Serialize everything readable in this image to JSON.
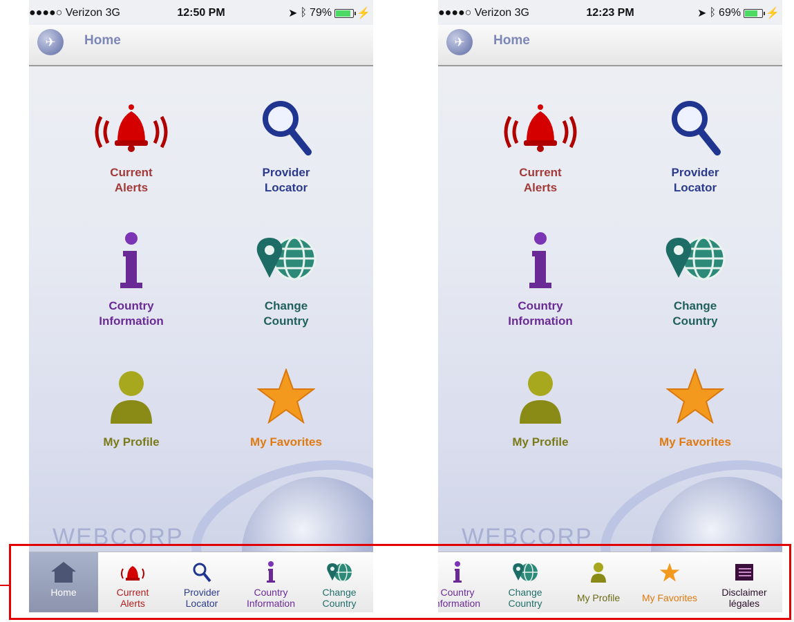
{
  "colors": {
    "alerts": "#a33a3a",
    "provider": "#2b3a8c",
    "country_info": "#6a2a96",
    "change_country": "#1f5f5c",
    "profile": "#7a7a1a",
    "favorites": "#e07a10",
    "active_tab_bg": "#9aa2bd",
    "red_outline": "#e30000"
  },
  "phones": [
    {
      "status": {
        "carrier": "●●●●○ Verizon  3G",
        "time": "12:50 PM",
        "battery": "79%",
        "battery_level": 0.79
      },
      "nav_title": "Home",
      "tiles": [
        {
          "line1": "Current",
          "line2": "Alerts",
          "icon": "bell-icon"
        },
        {
          "line1": "Provider",
          "line2": "Locator",
          "icon": "magnifier-icon"
        },
        {
          "line1": "Country",
          "line2": "Information",
          "icon": "info-icon"
        },
        {
          "line1": "Change",
          "line2": "Country",
          "icon": "globe-pin-icon"
        },
        {
          "line1": "My Profile",
          "line2": "",
          "icon": "profile-icon"
        },
        {
          "line1": "My Favorites",
          "line2": "",
          "icon": "star-icon"
        }
      ],
      "brand": "WEBCORP",
      "tabs": [
        {
          "line1": "Home",
          "line2": "",
          "icon": "home-icon",
          "active": true
        },
        {
          "line1": "Current",
          "line2": "Alerts",
          "icon": "bell-icon"
        },
        {
          "line1": "Provider",
          "line2": "Locator",
          "icon": "magnifier-icon"
        },
        {
          "line1": "Country",
          "line2": "Information",
          "icon": "info-icon"
        },
        {
          "line1": "Change",
          "line2": "Country",
          "icon": "globe-pin-icon"
        }
      ]
    },
    {
      "status": {
        "carrier": "●●●●○ Verizon  3G",
        "time": "12:23 PM",
        "battery": "69%",
        "battery_level": 0.69
      },
      "nav_title": "Home",
      "tiles": [
        {
          "line1": "Current",
          "line2": "Alerts",
          "icon": "bell-icon"
        },
        {
          "line1": "Provider",
          "line2": "Locator",
          "icon": "magnifier-icon"
        },
        {
          "line1": "Country",
          "line2": "Information",
          "icon": "info-icon"
        },
        {
          "line1": "Change",
          "line2": "Country",
          "icon": "globe-pin-icon"
        },
        {
          "line1": "My Profile",
          "line2": "",
          "icon": "profile-icon"
        },
        {
          "line1": "My Favorites",
          "line2": "",
          "icon": "star-icon"
        }
      ],
      "brand": "WEBCORP",
      "tabs": [
        {
          "line1": "Country",
          "line2": "nformation",
          "icon": "info-icon"
        },
        {
          "line1": "Change",
          "line2": "Country",
          "icon": "globe-pin-icon"
        },
        {
          "line1": "My Profile",
          "line2": "",
          "icon": "profile-icon"
        },
        {
          "line1": "My Favorites",
          "line2": "",
          "icon": "star-icon"
        },
        {
          "line1": "Disclaimer",
          "line2": "légales",
          "icon": "document-icon"
        }
      ]
    }
  ]
}
